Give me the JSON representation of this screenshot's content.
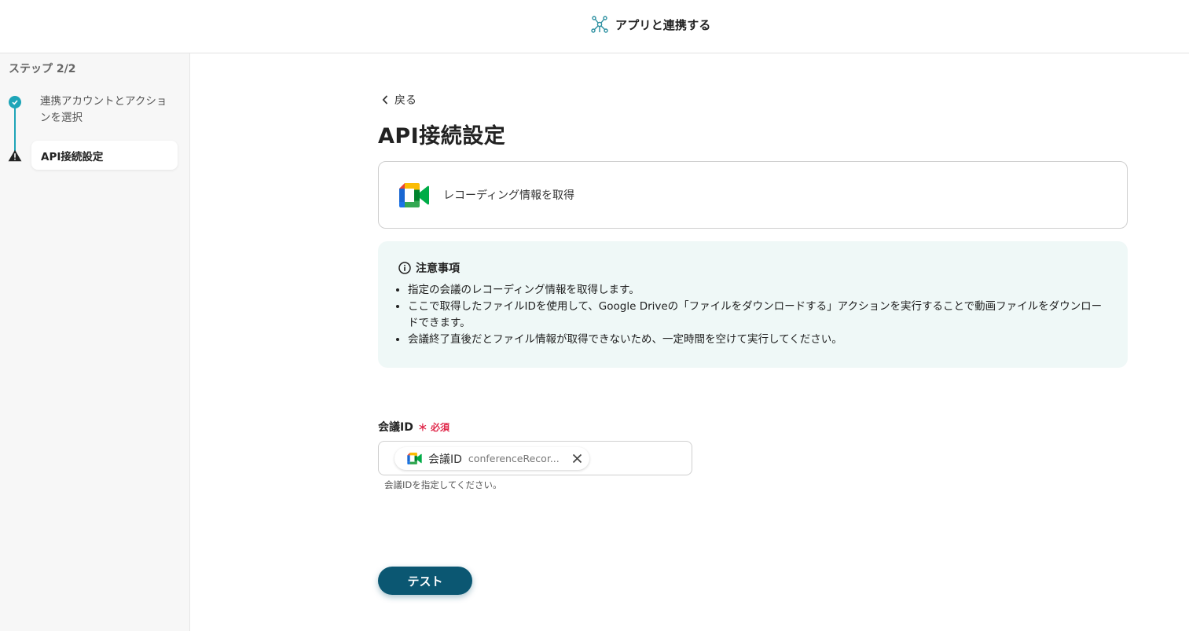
{
  "header": {
    "title": "アプリと連携する",
    "icon": "network-icon"
  },
  "sidebar": {
    "step_label": "ステップ 2/2",
    "steps": [
      {
        "label": "連携アカウントとアクションを選択",
        "status": "done"
      },
      {
        "label": "API接続設定",
        "status": "warning"
      }
    ]
  },
  "main": {
    "back_label": "戻る",
    "page_title": "API接続設定",
    "action": {
      "label": "レコーディング情報を取得",
      "icon": "google-meet-icon"
    },
    "notice": {
      "title": "注意事項",
      "items": [
        "指定の会議のレコーディング情報を取得します。",
        "ここで取得したファイルIDを使用して、Google Driveの「ファイルをダウンロードする」アクションを実行することで動画ファイルをダウンロードできます。",
        "会議終了直後だとファイル情報が取得できないため、一定時間を空けて実行してください。"
      ]
    },
    "field": {
      "label": "会議ID",
      "required": "＊ 必須",
      "chip_label": "会議ID",
      "chip_value": "conferenceRecor...",
      "help": "会議IDを指定してください。"
    },
    "test_button": "テスト"
  },
  "colors": {
    "accent": "#1ea5b8",
    "button": "#0b5772",
    "required": "#e0284a",
    "notice_bg": "#eff8f7"
  }
}
